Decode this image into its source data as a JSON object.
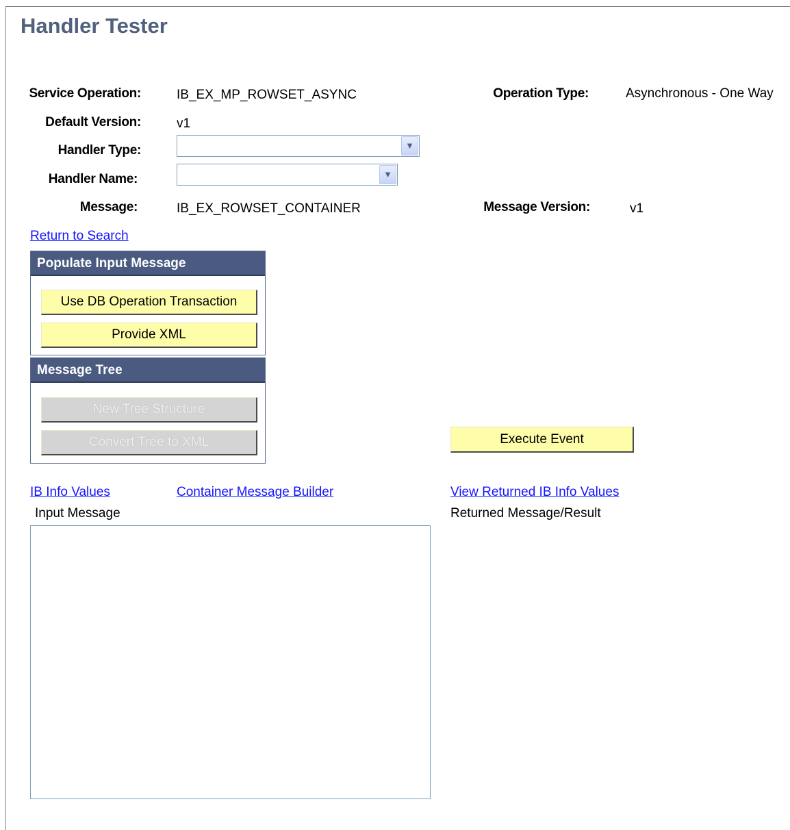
{
  "page": {
    "title": "Handler Tester"
  },
  "fields": {
    "service_operation_label": "Service Operation:",
    "service_operation_value": "IB_EX_MP_ROWSET_ASYNC",
    "operation_type_label": "Operation Type:",
    "operation_type_value": "Asynchronous - One Way",
    "default_version_label": "Default Version:",
    "default_version_value": "v1",
    "handler_type_label": "Handler Type:",
    "handler_type_value": "",
    "handler_name_label": "Handler Name:",
    "handler_name_value": "",
    "message_label": "Message:",
    "message_value": "IB_EX_ROWSET_CONTAINER",
    "message_version_label": "Message Version:",
    "message_version_value": "v1"
  },
  "links": {
    "return_to_search": "Return to Search",
    "ib_info_values": "IB Info Values",
    "container_message_builder": "Container Message Builder",
    "view_returned_ib_info_values": "View Returned IB Info Values"
  },
  "populate_input": {
    "header": "Populate Input Message",
    "use_db_operation_transaction": "Use DB Operation Transaction",
    "provide_xml": "Provide XML"
  },
  "message_tree": {
    "header": "Message Tree",
    "new_tree_structure": "New Tree Structure",
    "convert_tree_to_xml": "Convert Tree to XML"
  },
  "execute_event": "Execute Event",
  "input_message": {
    "label": "Input Message",
    "value": ""
  },
  "returned_message": {
    "label": "Returned Message/Result"
  },
  "colors": {
    "title": "#51607d",
    "link": "#1414ff",
    "button_bg": "#fdfdaa",
    "group_header_bg": "#4a5a80",
    "disabled_button_bg": "#d4d4d4"
  }
}
